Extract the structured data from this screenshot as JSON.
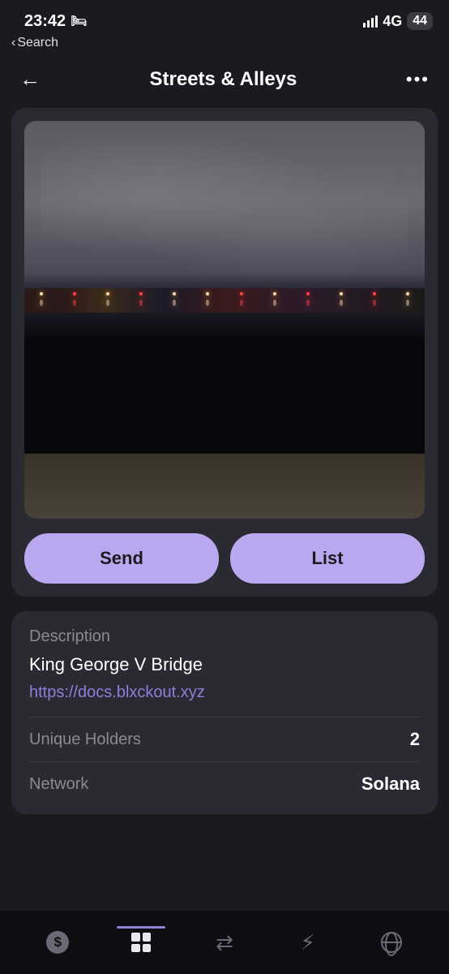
{
  "status": {
    "time": "23:42",
    "network_label": "4G",
    "battery_level": "44",
    "back_pill_text": "Search"
  },
  "nav": {
    "title": "Streets & Alleys"
  },
  "actions": {
    "send_label": "Send",
    "list_label": "List"
  },
  "details": {
    "description_label": "Description",
    "description_value": "King George V Bridge",
    "link_text": "https://docs.blxckout.xyz",
    "holders_label": "Unique Holders",
    "holders_value": "2",
    "network_label": "Network",
    "network_value": "Solana"
  }
}
